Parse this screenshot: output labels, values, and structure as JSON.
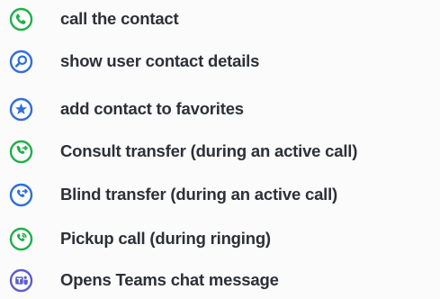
{
  "legend": {
    "items": [
      {
        "icon": "phone-icon",
        "color": "#1fb04a",
        "label": "call the contact"
      },
      {
        "icon": "search-icon",
        "color": "#2f6fd8",
        "label": "show user contact details"
      },
      {
        "icon": "star-icon",
        "color": "#2f6fd8",
        "label": "add contact to favorites"
      },
      {
        "icon": "consult-transfer-icon",
        "color": "#1fb04a",
        "label": "Consult transfer (during an active call)"
      },
      {
        "icon": "blind-transfer-icon",
        "color": "#2f6fd8",
        "label": "Blind transfer (during an active call)"
      },
      {
        "icon": "pickup-call-icon",
        "color": "#1fb04a",
        "label": "Pickup call (during ringing)"
      },
      {
        "icon": "teams-chat-icon",
        "color": "#5b5fc7",
        "label": "Opens Teams chat message"
      }
    ]
  }
}
